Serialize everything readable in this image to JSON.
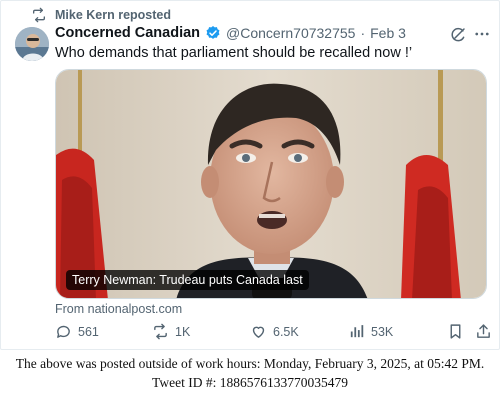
{
  "repost": {
    "label": "Mike Kern reposted"
  },
  "author": {
    "name": "Concerned Canadian",
    "handle": "@Concern70732755",
    "separator": "·",
    "date": "Feb 3"
  },
  "tweet": {
    "text": "Who demands that parliament should be recalled now !’"
  },
  "card": {
    "caption": "Terry Newman: Trudeau puts Canada last",
    "source": "From nationalpost.com"
  },
  "actions": {
    "replies": "561",
    "reposts": "1K",
    "likes": "6.5K",
    "views": "53K"
  },
  "footer": {
    "line1": "The above was posted outside of work hours: Monday, February 3, 2025, at 05:42 PM.",
    "line2": "Tweet ID #: 1886576133770035479"
  },
  "colors": {
    "verified": "#1d9bf0",
    "muted": "#536471",
    "text": "#0f1419"
  }
}
